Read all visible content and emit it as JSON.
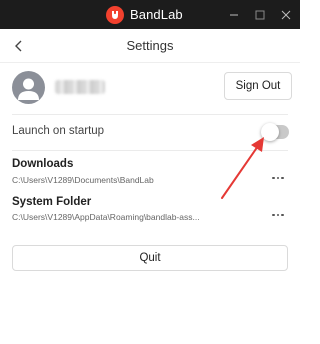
{
  "window": {
    "brand_name": "BandLab",
    "brand_color": "#f2412e",
    "titlebar_color": "#1c1c1c",
    "controls": [
      "minimize-icon",
      "maximize-icon",
      "close-icon"
    ]
  },
  "header": {
    "title": "Settings",
    "back_icon": "chevron-left-icon"
  },
  "profile": {
    "avatar_icon": "user-icon",
    "username_blurred": true,
    "sign_out_label": "Sign Out"
  },
  "startup": {
    "label": "Launch on startup",
    "enabled": false
  },
  "folders": [
    {
      "title": "Downloads",
      "path": "C:\\Users\\V1289\\Documents\\BandLab",
      "menu_icon": "more-horizontal-icon"
    },
    {
      "title": "System Folder",
      "path": "C:\\Users\\V1289\\AppData\\Roaming\\bandlab-ass...",
      "menu_icon": "more-horizontal-icon"
    }
  ],
  "quit_label": "Quit",
  "annotation": {
    "arrow_color": "#e53935"
  }
}
